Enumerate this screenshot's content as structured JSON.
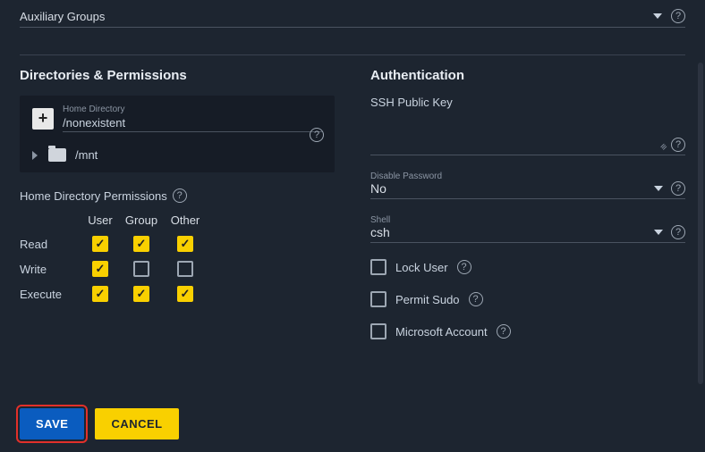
{
  "aux_groups": {
    "label": "Auxiliary Groups"
  },
  "left": {
    "title": "Directories & Permissions",
    "home_label": "Home Directory",
    "home_value": "/nonexistent",
    "mnt_label": "/mnt",
    "perm_title": "Home Directory Permissions",
    "headers": {
      "c0": "",
      "c1": "User",
      "c2": "Group",
      "c3": "Other"
    },
    "rows": {
      "read": {
        "label": "Read",
        "user": true,
        "group": true,
        "other": true
      },
      "write": {
        "label": "Write",
        "user": true,
        "group": false,
        "other": false
      },
      "execute": {
        "label": "Execute",
        "user": true,
        "group": true,
        "other": true
      }
    }
  },
  "right": {
    "title": "Authentication",
    "ssh_label": "SSH Public Key",
    "disable_pw_label": "Disable Password",
    "disable_pw_value": "No",
    "shell_label": "Shell",
    "shell_value": "csh",
    "lock_user": {
      "label": "Lock User",
      "checked": false
    },
    "permit_sudo": {
      "label": "Permit Sudo",
      "checked": false
    },
    "ms_account": {
      "label": "Microsoft Account",
      "checked": false
    }
  },
  "buttons": {
    "save": "SAVE",
    "cancel": "CANCEL"
  },
  "glyphs": {
    "q": "?",
    "plus": "+",
    "check": "✓"
  }
}
